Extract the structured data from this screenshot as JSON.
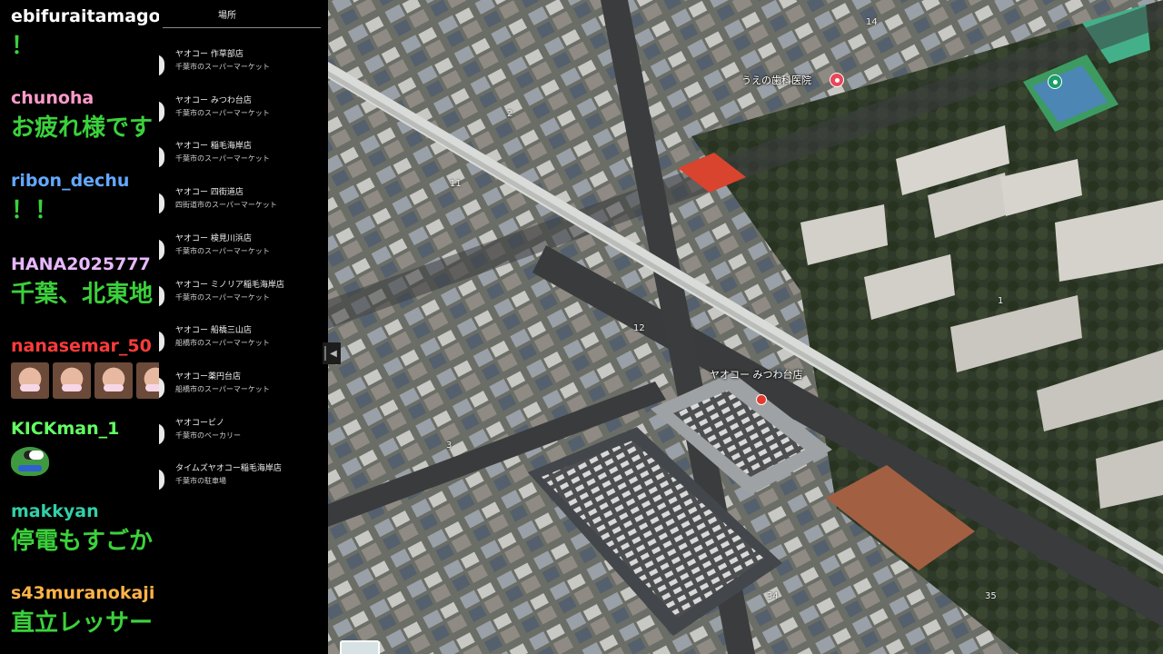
{
  "chat": {
    "messages": [
      {
        "user": "ebifuraitamago",
        "user_color": "#ffffff",
        "text": "！"
      },
      {
        "user": "chunoha",
        "user_color": "#ff9acb",
        "text": "お疲れ様です"
      },
      {
        "user": "ribon_dechu",
        "user_color": "#63a8ff",
        "text": "！！"
      },
      {
        "user": "HANA2025777",
        "user_color": "#e9b8ff",
        "text": "千葉、北東地"
      },
      {
        "user": "nanasemar_50",
        "user_color": "#ff3b3b",
        "text": ""
      },
      {
        "user": "KICKman_1",
        "user_color": "#63ff63",
        "text": ""
      },
      {
        "user": "makkyan",
        "user_color": "#31d0a8",
        "text": "停電もすごか"
      },
      {
        "user": "s43muranokaji",
        "user_color": "#ffb347",
        "text": "直立レッサー"
      }
    ],
    "emotes_for": "nanasemar_50",
    "emote_icon": "face-emote-icon",
    "sticker_icon": "frog-sticker-icon"
  },
  "panel": {
    "title": "場所",
    "items": [
      {
        "name": "ヤオコー 作草部店",
        "category": "千葉市のスーパーマーケット"
      },
      {
        "name": "ヤオコー みつわ台店",
        "category": "千葉市のスーパーマーケット"
      },
      {
        "name": "ヤオコー 稲毛海岸店",
        "category": "千葉市のスーパーマーケット"
      },
      {
        "name": "ヤオコー 四街道店",
        "category": "四街道市のスーパーマーケット"
      },
      {
        "name": "ヤオコー 検見川浜店",
        "category": "千葉市のスーパーマーケット"
      },
      {
        "name": "ヤオコー ミノリア稲毛海岸店",
        "category": "千葉市のスーパーマーケット"
      },
      {
        "name": "ヤオコー 船橋三山店",
        "category": "船橋市のスーパーマーケット"
      },
      {
        "name": "ヤオコー薬円台店",
        "category": "船橋市のスーパーマーケット"
      },
      {
        "name": "ヤオコービノ",
        "category": "千葉市のベーカリー"
      },
      {
        "name": "タイムズヤオコー稲毛海岸店",
        "category": "千葉市の駐車場"
      }
    ],
    "collapse_glyph": "◀"
  },
  "map": {
    "selected_label": "ヤオコー みつわ台店",
    "clinic_label": "うえの歯科医院",
    "numbers": [
      "14",
      "2",
      "11",
      "12",
      "1",
      "34",
      "35",
      "3"
    ],
    "marker_color": "#e23a2e",
    "park_poi_color": "#1a9e6a",
    "clinic_poi_color": "#e8475a"
  }
}
